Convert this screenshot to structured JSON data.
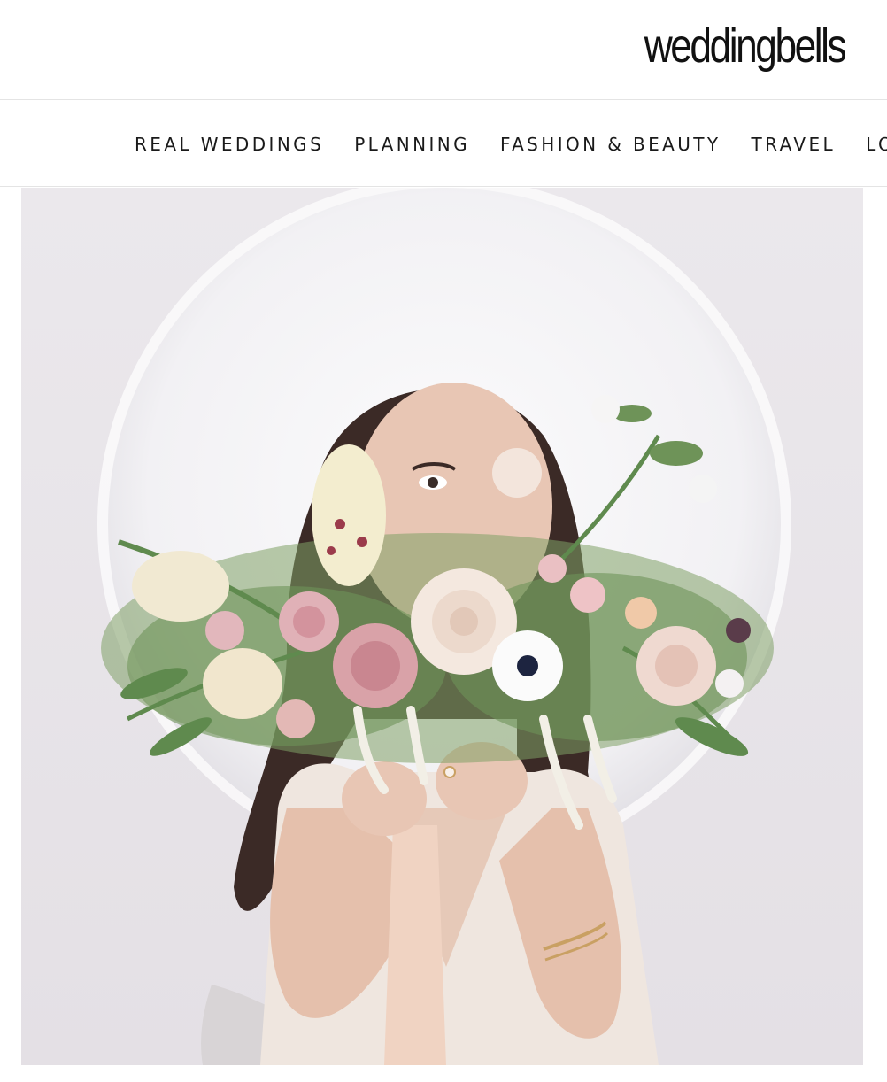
{
  "header": {
    "logo_text": "weddingbells"
  },
  "nav": {
    "items": [
      {
        "label": "REAL WEDDINGS"
      },
      {
        "label": "PLANNING"
      },
      {
        "label": "FASHION & BEAUTY"
      },
      {
        "label": "TRAVEL"
      },
      {
        "label": "LO"
      }
    ]
  },
  "hero": {
    "colors": {
      "wall": "#e9e6ea",
      "mirror": "#f7f6f8",
      "hair": "#3b2a26",
      "skin": "#e8c6b4",
      "dress": "#efe6df",
      "ribbon": "#f0d3c2",
      "rose_pink": "#d9a2a8",
      "rose_cream": "#f4e8df",
      "leaf": "#5f8a4e"
    }
  }
}
